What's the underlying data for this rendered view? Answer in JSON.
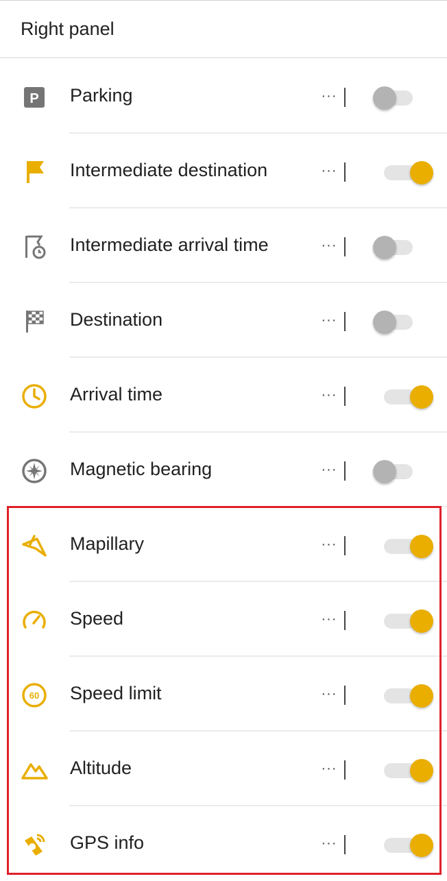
{
  "header": {
    "title": "Right panel"
  },
  "colors": {
    "accent": "#E9AE00",
    "icon_gray": "#757575",
    "highlight_border": "#E0202A"
  },
  "items": [
    {
      "label": "Parking",
      "icon": "parking-icon",
      "more": "···",
      "enabled": false
    },
    {
      "label": "Intermediate destination",
      "icon": "flag-icon",
      "more": "···",
      "enabled": true
    },
    {
      "label": "Intermediate arrival time",
      "icon": "flag-clock-icon",
      "more": "···",
      "enabled": false
    },
    {
      "label": "Destination",
      "icon": "checkered-flag-icon",
      "more": "···",
      "enabled": false
    },
    {
      "label": "Arrival time",
      "icon": "clock-icon",
      "more": "···",
      "enabled": true
    },
    {
      "label": "Magnetic bearing",
      "icon": "compass-icon",
      "more": "···",
      "enabled": false
    },
    {
      "label": "Mapillary",
      "icon": "mapillary-icon",
      "more": "···",
      "enabled": true
    },
    {
      "label": "Speed",
      "icon": "speedometer-icon",
      "more": "···",
      "enabled": true
    },
    {
      "label": "Speed limit",
      "icon": "speed-limit-icon",
      "icon_text": "60",
      "more": "···",
      "enabled": true
    },
    {
      "label": "Altitude",
      "icon": "mountain-icon",
      "more": "···",
      "enabled": true
    },
    {
      "label": "GPS info",
      "icon": "satellite-icon",
      "more": "···",
      "enabled": true
    }
  ]
}
